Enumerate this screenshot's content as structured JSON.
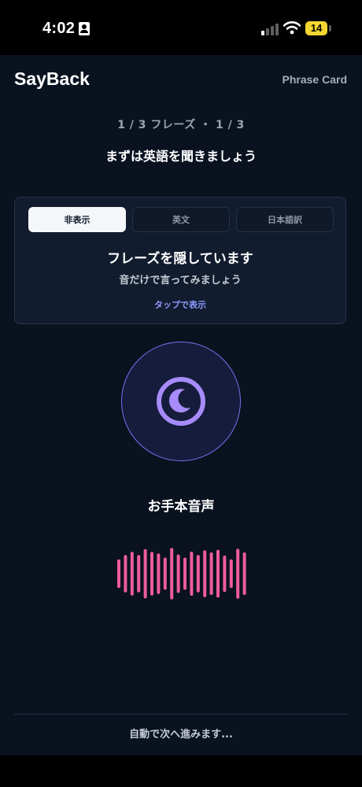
{
  "status_bar": {
    "time": "4:02",
    "battery": "14"
  },
  "header": {
    "brand": "SayBack",
    "link": "Phrase Card"
  },
  "progress": "1 / 3 フレーズ ・ 1 / 3",
  "prompt": "まずは英語を聞きましょう",
  "card": {
    "tabs": [
      {
        "label": "非表示",
        "active": true
      },
      {
        "label": "英文",
        "active": false
      },
      {
        "label": "日本語訳",
        "active": false
      }
    ],
    "title": "フレーズを隠しています",
    "subtitle": "音だけで言ってみましょう",
    "reveal_link": "タップで表示"
  },
  "audio": {
    "label": "お手本音声",
    "waveform_levels": [
      0.55,
      0.72,
      0.84,
      0.72,
      0.95,
      0.84,
      0.78,
      0.62,
      0.99,
      0.74,
      0.62,
      0.85,
      0.72,
      0.9,
      0.82,
      0.92,
      0.7,
      0.55,
      0.96,
      0.82
    ]
  },
  "footer": {
    "text": "自動で次へ進みます..."
  },
  "colors": {
    "background": "#0a1220",
    "accent": "#7b6ef0",
    "link": "#8e9bff",
    "waveform": "#ee5c9c",
    "battery": "#f4d631"
  }
}
